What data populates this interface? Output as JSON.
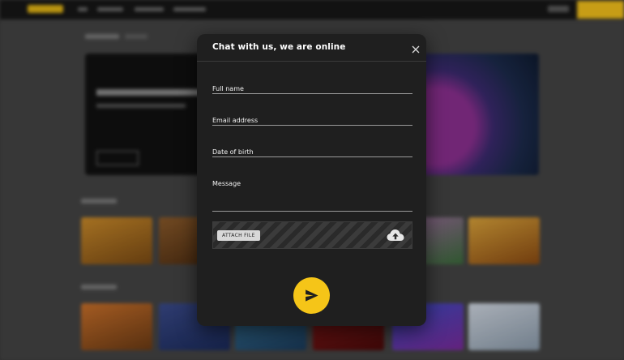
{
  "modal": {
    "title": "Chat with us, we are online",
    "close_icon": "close-icon",
    "fields": {
      "full_name": {
        "label": "Full name",
        "value": ""
      },
      "email": {
        "label": "Email address",
        "value": ""
      },
      "dob": {
        "label": "Date of birth",
        "value": ""
      },
      "message": {
        "label": "Message",
        "value": ""
      }
    },
    "attach": {
      "button_label": "ATTACH FILE",
      "icon": "cloud-upload-icon"
    },
    "send": {
      "icon": "send-icon"
    }
  },
  "colors": {
    "accent": "#f5c518",
    "modal_bg": "#1f1f1f",
    "overlay": "#3a3a3a"
  }
}
